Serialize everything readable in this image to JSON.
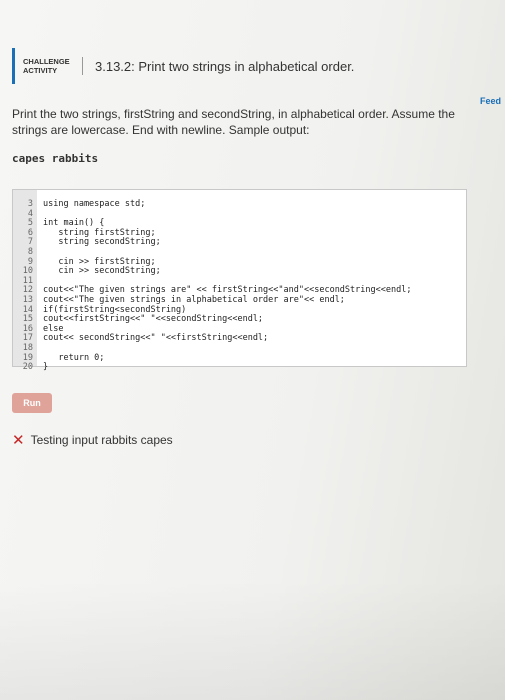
{
  "feed_link": "Feed",
  "activity": {
    "badge_line1": "CHALLENGE",
    "badge_line2": "ACTIVITY",
    "title": "3.13.2: Print two strings in alphabetical order."
  },
  "instructions": "Print the two strings, firstString and secondString, in alphabetical order. Assume the strings are lowercase. End with newline. Sample output:",
  "sample_output": "capes rabbits",
  "editor": {
    "lines": [
      {
        "num": "3",
        "text": "using namespace std;"
      },
      {
        "num": "4",
        "text": ""
      },
      {
        "num": "5",
        "text": "int main() {"
      },
      {
        "num": "6",
        "text": "   string firstString;"
      },
      {
        "num": "7",
        "text": "   string secondString;"
      },
      {
        "num": "8",
        "text": ""
      },
      {
        "num": "9",
        "text": "   cin >> firstString;"
      },
      {
        "num": "10",
        "text": "   cin >> secondString;"
      },
      {
        "num": "11",
        "text": ""
      },
      {
        "num": "12",
        "text": "cout<<\"The given strings are\" << firstString<<\"and\"<<secondString<<endl;"
      },
      {
        "num": "13",
        "text": "cout<<\"The given strings in alphabetical order are\"<< endl;"
      },
      {
        "num": "14",
        "text": "if(firstString<secondString)"
      },
      {
        "num": "15",
        "text": "cout<<firstString<<\" \"<<secondString<<endl;"
      },
      {
        "num": "16",
        "text": "else"
      },
      {
        "num": "17",
        "text": "cout<< secondString<<\" \"<<firstString<<endl;"
      },
      {
        "num": "18",
        "text": ""
      },
      {
        "num": "19",
        "text": "   return 0;"
      },
      {
        "num": "20",
        "text": "}"
      }
    ]
  },
  "run_label": "Run",
  "result": {
    "status_icon": "x-icon",
    "text": "Testing input rabbits capes",
    "status_color": "#c62828"
  }
}
